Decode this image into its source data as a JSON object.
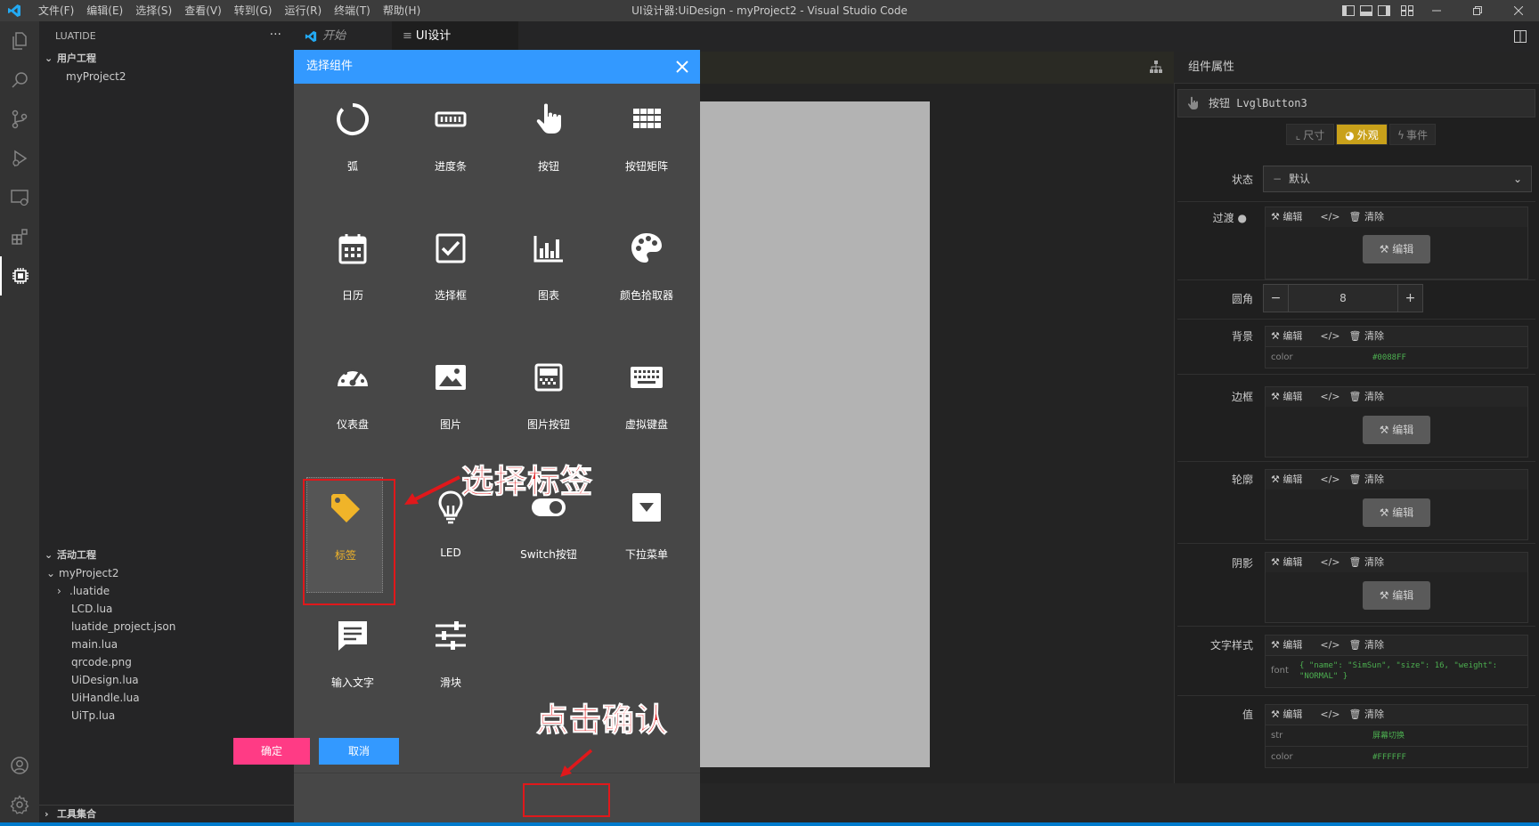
{
  "window": {
    "title": "UI设计器:UiDesign - myProject2 - Visual Studio Code",
    "menu": [
      "文件(F)",
      "编辑(E)",
      "选择(S)",
      "查看(V)",
      "转到(G)",
      "运行(R)",
      "终端(T)",
      "帮助(H)"
    ]
  },
  "sidebar": {
    "header": "LUATIDE",
    "more": "···",
    "user_project": {
      "title": "用户工程",
      "items": [
        "myProject2"
      ]
    },
    "active_project": {
      "title": "活动工程",
      "root": "myProject2",
      "folder": ".luatide",
      "files": [
        "LCD.lua",
        "luatide_project.json",
        "main.lua",
        "qrcode.png",
        "UiDesign.lua",
        "UiHandle.lua",
        "UiTp.lua"
      ]
    },
    "tools": "工具集合"
  },
  "tabs": [
    {
      "label": "开始",
      "active": false
    },
    {
      "label": "UI设计器:UiDesign",
      "active": true,
      "close": "×"
    }
  ],
  "dialog": {
    "title": "选择组件",
    "components": [
      {
        "label": "弧",
        "icon": "arc-icon"
      },
      {
        "label": "进度条",
        "icon": "progress-bar-icon"
      },
      {
        "label": "按钮",
        "icon": "pointer-hand-icon"
      },
      {
        "label": "按钮矩阵",
        "icon": "button-matrix-icon"
      },
      {
        "label": "日历",
        "icon": "calendar-icon"
      },
      {
        "label": "选择框",
        "icon": "checkbox-icon"
      },
      {
        "label": "图表",
        "icon": "chart-icon"
      },
      {
        "label": "颜色拾取器",
        "icon": "palette-icon"
      },
      {
        "label": "仪表盘",
        "icon": "gauge-icon"
      },
      {
        "label": "图片",
        "icon": "image-icon"
      },
      {
        "label": "图片按钮",
        "icon": "image-button-icon"
      },
      {
        "label": "虚拟键盘",
        "icon": "keyboard-icon"
      },
      {
        "label": "标签",
        "icon": "tag-icon",
        "selected": true
      },
      {
        "label": "LED",
        "icon": "lightbulb-icon"
      },
      {
        "label": "Switch按钮",
        "icon": "toggle-switch-icon"
      },
      {
        "label": "下拉菜单",
        "icon": "dropdown-icon"
      },
      {
        "label": "输入文字",
        "icon": "text-input-icon"
      },
      {
        "label": "滑块",
        "icon": "slider-icon"
      }
    ],
    "confirm": "确定",
    "cancel": "取消"
  },
  "annotations": {
    "select_label": "选择标签",
    "click_confirm": "点击确认"
  },
  "properties": {
    "title": "组件属性",
    "component": "按钮 LvglButton3",
    "tabs": [
      "尺寸",
      "外观",
      "事件"
    ],
    "active_tab": "外观",
    "toolbar": {
      "edit": "编辑",
      "code": "</>",
      "clear": "清除"
    },
    "edit_button": "编辑",
    "state": {
      "label": "状态",
      "value": "默认"
    },
    "transition": {
      "label": "过渡"
    },
    "radius": {
      "label": "圆角",
      "value": "8",
      "minus": "−",
      "plus": "+"
    },
    "background": {
      "label": "背景",
      "key": "color",
      "value": "#0088FF"
    },
    "border": {
      "label": "边框"
    },
    "outline": {
      "label": "轮廓"
    },
    "shadow": {
      "label": "阴影"
    },
    "text_style": {
      "label": "文字样式",
      "key": "font",
      "value": "{ \"name\": \"SimSun\", \"size\": 16, \"weight\": \"NORMAL\" }"
    },
    "value": {
      "label": "值",
      "rows": [
        {
          "key": "str",
          "value": "屏幕切换"
        },
        {
          "key": "color",
          "value": "#FFFFFF"
        }
      ]
    }
  },
  "colors": {
    "accent_blue": "#3399ff",
    "confirm_pink": "#ff3b85",
    "annotation_red": "#e0181b",
    "selected_label": "#f0b429",
    "active_tab_gold": "#c9a11a"
  }
}
